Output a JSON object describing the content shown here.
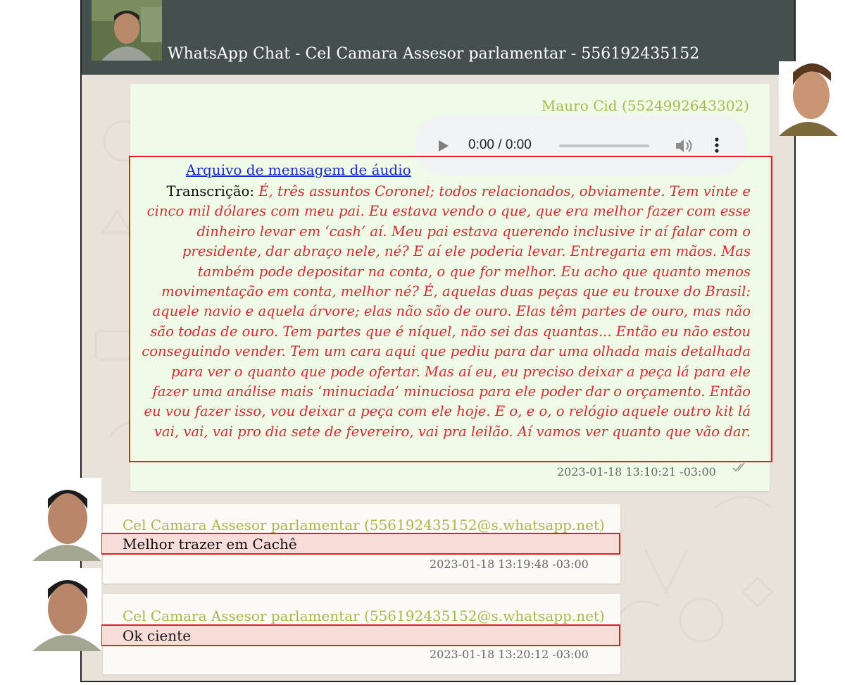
{
  "header": {
    "title": "WhatsApp Chat - Cel Camara Assesor parlamentar - 556192435152"
  },
  "messages": [
    {
      "sender": "Mauro Cid (5524992643302)",
      "audio": {
        "time": "0:00 / 0:00",
        "progress": 0
      },
      "attachment_link": "Arquivo de mensagem de áudio ",
      "transcript_label": "Transcrição:",
      "transcript_text": "É, três assuntos Coronel; todos relacionados, obviamente. Tem vinte e cinco mil dólares com meu pai. Eu estava vendo o que, que era melhor fazer com esse dinheiro levar em ‘cash’ aí. Meu pai estava querendo inclusive ir aí falar com o presidente, dar abraço nele, né? E aí ele poderia levar. Entregaria em mãos. Mas também pode depositar na conta, o que for melhor. Eu acho que quanto menos movimentação em conta, melhor né? É, aquelas duas peças que eu trouxe do Brasil: aquele navio e aquela árvore; elas não são de ouro. Elas têm partes de ouro, mas não são todas de ouro. Tem partes que é níquel, não sei das quantas... Então eu não estou conseguindo vender. Tem um cara aqui que pediu para dar uma olhada mais detalhada para ver o quanto que pode ofertar. Mas aí eu, eu preciso deixar a peça lá para ele fazer uma análise mais ‘minuciada’ minuciosa para ele poder dar o orçamento. Então eu vou fazer isso, vou deixar a peça com ele hoje. E o, e o, o relógio aquele outro kit lá vai, vai, vai pro dia sete de fevereiro, vai pra leilão. Aí vamos ver quanto que vão dar.",
      "timestamp": "2023-01-18 13:10:21 -03:00"
    },
    {
      "sender": "Cel Camara Assesor parlamentar (556192435152@s.whatsapp.net)",
      "text": "Melhor trazer em Cachê",
      "timestamp": "2023-01-18 13:19:48 -03:00"
    },
    {
      "sender": "Cel Camara Assesor parlamentar (556192435152@s.whatsapp.net)",
      "text": "Ok ciente",
      "timestamp": "2023-01-18 13:20:12 -03:00"
    }
  ],
  "icons": {
    "play": "play-icon",
    "volume": "volume-icon",
    "more": "more-vertical-icon",
    "read_receipt": "double-check-icon"
  },
  "colors": {
    "header_bg": "#444f4e",
    "outgoing_bubble": "#effbe6",
    "incoming_bubble": "#fbfaf6",
    "sender_name": "#a9b84a",
    "transcript_text": "#d92a34",
    "highlight_border": "#e01e24",
    "link": "#1a2bcc"
  }
}
